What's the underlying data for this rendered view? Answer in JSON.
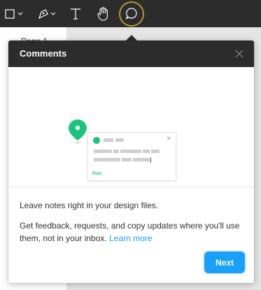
{
  "toolbar": {
    "tools": [
      {
        "name": "frame-tool",
        "icon": "frame-icon"
      },
      {
        "name": "pen-tool",
        "icon": "pen-icon"
      },
      {
        "name": "text-tool",
        "icon": "text-icon",
        "glyph": "T"
      },
      {
        "name": "hand-tool",
        "icon": "hand-icon"
      },
      {
        "name": "comment-tool",
        "icon": "comment-icon",
        "active": true
      }
    ]
  },
  "left_panel": {
    "page_label": "Page 1"
  },
  "popover": {
    "title": "Comments",
    "illustration": {
      "post_label": "Post"
    },
    "text_primary": "Leave notes right in your design files.",
    "text_secondary": "Get feedback, requests, and copy updates where you'll use them, not in your inbox.",
    "learn_more": "Learn more",
    "next_label": "Next"
  },
  "colors": {
    "toolbar_bg": "#2c2c2c",
    "accent": "#18a0fb",
    "active_ring": "#b49a2f",
    "green": "#1bc47d"
  }
}
